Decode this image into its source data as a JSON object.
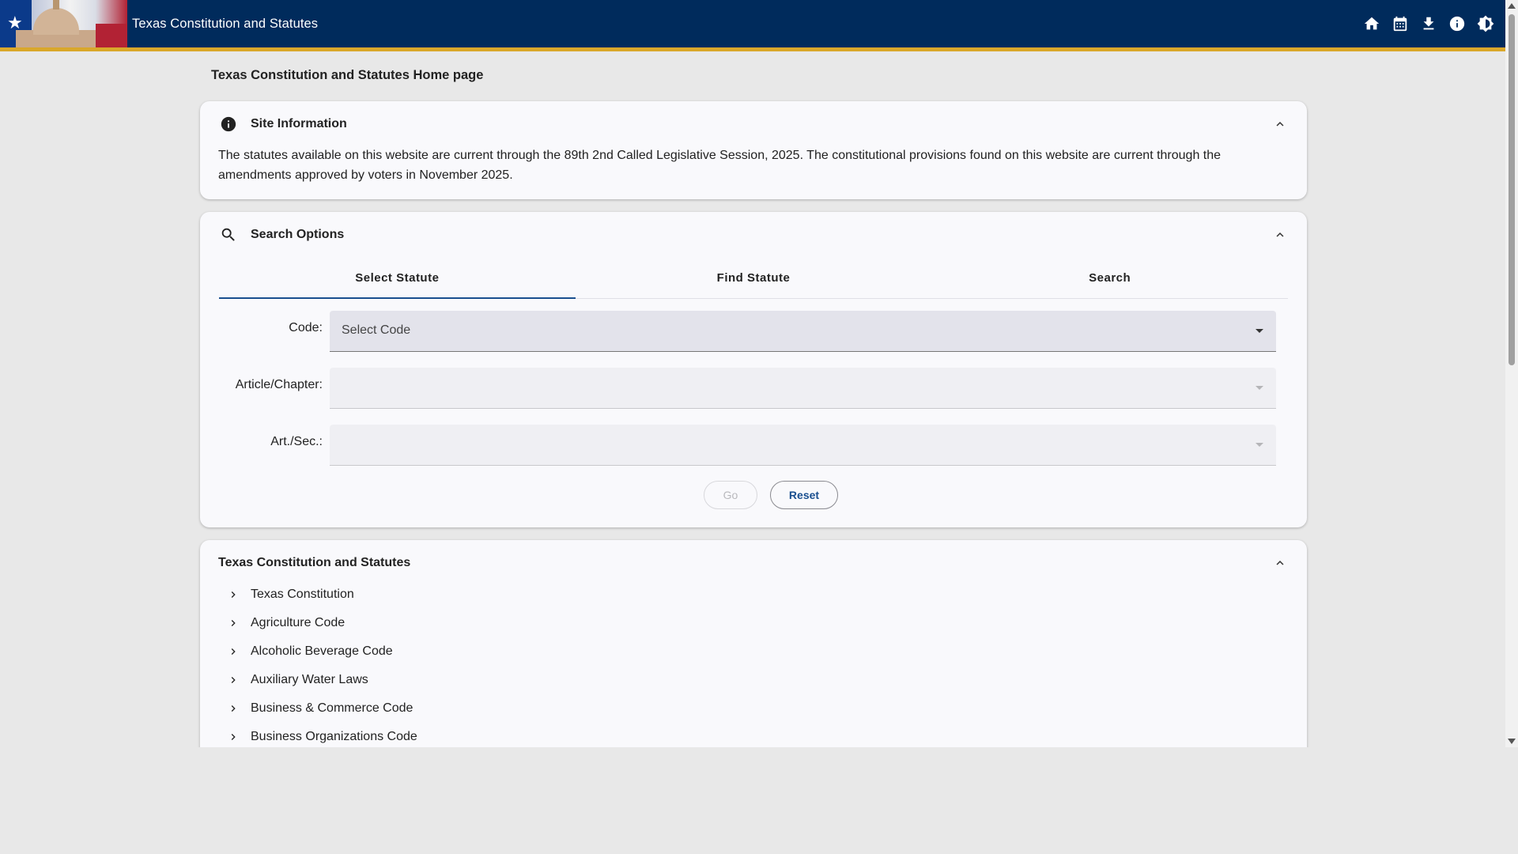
{
  "app_bar": {
    "title": "Texas Constitution and Statutes",
    "actions": [
      {
        "icon": "home-icon"
      },
      {
        "icon": "calendar-icon"
      },
      {
        "icon": "download-icon"
      },
      {
        "icon": "info-icon"
      },
      {
        "icon": "brightness-icon"
      }
    ]
  },
  "page": {
    "heading": "Texas Constitution and Statutes Home page"
  },
  "site_info": {
    "title": "Site Information",
    "text": "The statutes available on this website are current through the 89th 2nd Called Legislative Session, 2025. The constitutional provisions found on this website are current through the amendments approved by voters in November 2025."
  },
  "search_options": {
    "title": "Search Options",
    "tabs": [
      {
        "label": "Select Statute",
        "active": true
      },
      {
        "label": "Find Statute",
        "active": false
      },
      {
        "label": "Search",
        "active": false
      }
    ],
    "fields": [
      {
        "label": "Code:",
        "value": "Select Code",
        "disabled": false
      },
      {
        "label": "Article/Chapter:",
        "value": "",
        "disabled": true
      },
      {
        "label": "Art./Sec.:",
        "value": "",
        "disabled": true
      }
    ],
    "go_label": "Go",
    "reset_label": "Reset"
  },
  "statutes": {
    "title": "Texas Constitution and Statutes",
    "items": [
      "Texas Constitution",
      "Agriculture Code",
      "Alcoholic Beverage Code",
      "Auxiliary Water Laws",
      "Business & Commerce Code",
      "Business Organizations Code"
    ]
  },
  "colors": {
    "app_bar": "#002b5c",
    "app_bar_accent": "#d9a72a",
    "tab_indicator": "#1a4f8f",
    "background": "#e8e8e8"
  }
}
